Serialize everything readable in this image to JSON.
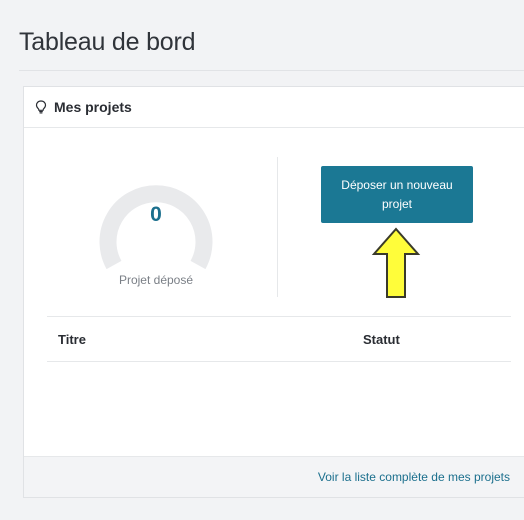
{
  "page": {
    "title": "Tableau de bord"
  },
  "card": {
    "title": "Mes projets",
    "icon": "lightbulb-icon",
    "gauge": {
      "value": "0",
      "caption": "Projet déposé",
      "fill_fraction": 0
    },
    "new_project_button": "Déposer un nouveau projet",
    "table": {
      "columns": [
        "Titre",
        "Statut"
      ],
      "rows": []
    },
    "footer_link": "Voir la liste complète de mes projets"
  },
  "annotation": {
    "arrow_color": "#fffd3a",
    "arrow_outline": "#3a3a2a",
    "icon": "up-arrow-icon"
  },
  "colors": {
    "accent": "#1b7894",
    "value": "#1b6f8d",
    "gauge_track": "#e9eaec"
  }
}
